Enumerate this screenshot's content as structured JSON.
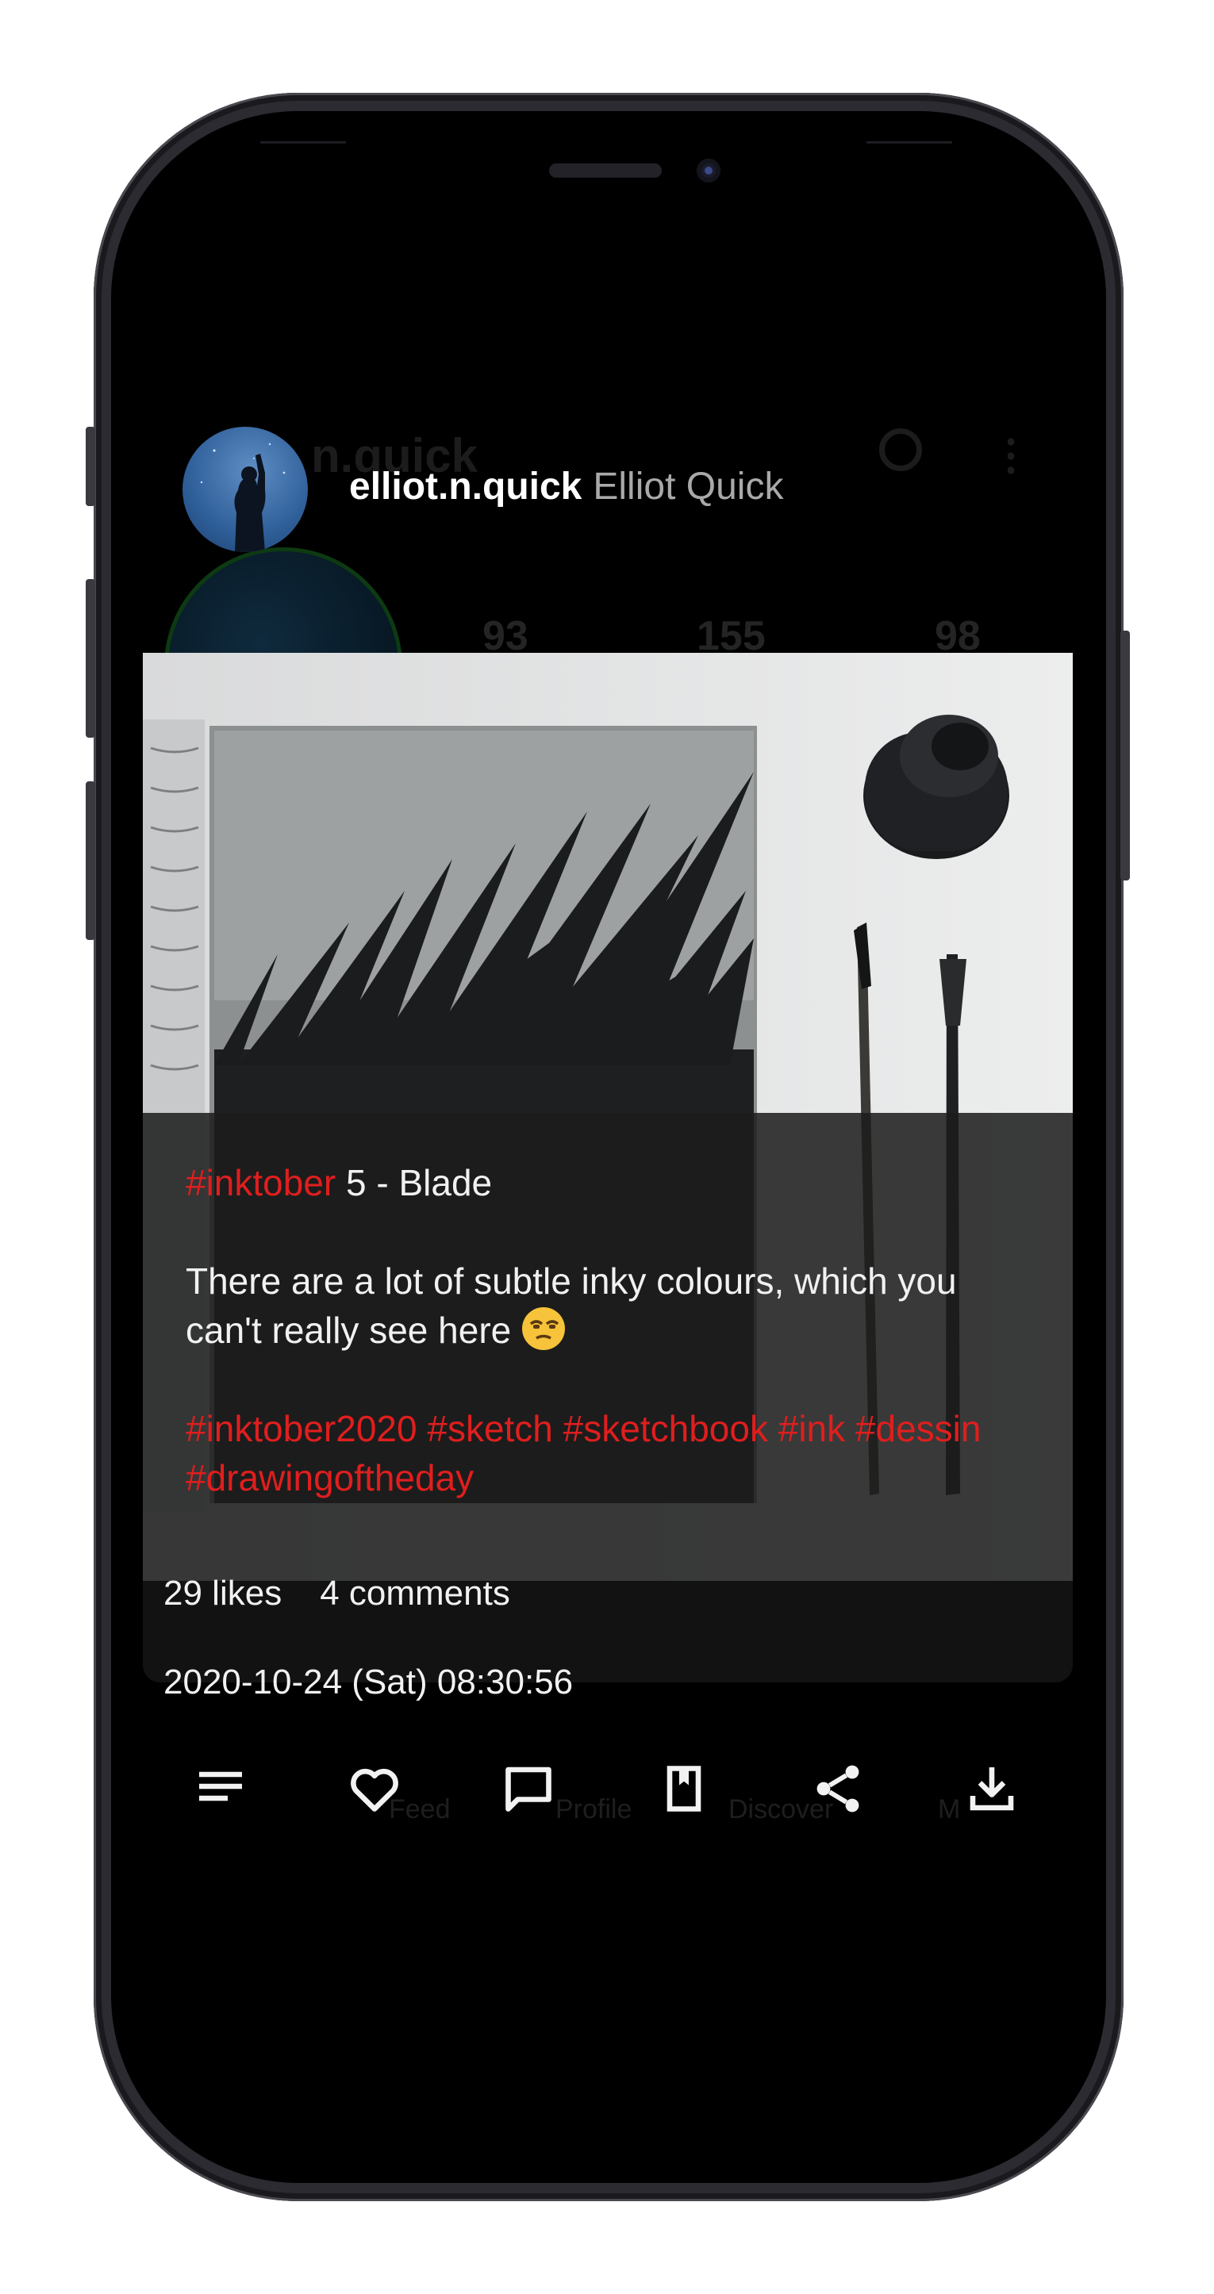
{
  "background_app": {
    "title": "n.quick",
    "stats": [
      "93",
      "155",
      "98"
    ],
    "nav_labels": [
      "Feed",
      "Profile",
      "Discover",
      "M"
    ]
  },
  "dialog": {
    "username": "elliot.n.quick",
    "full_name": "Elliot Quick",
    "caption": {
      "line1_tag": "#inktober",
      "line1_text": " 5 - Blade",
      "body": "There are a lot of subtle inky colours, which you can't really see here",
      "emoji": "unamused-face",
      "tags": [
        "#inktober2020",
        "#sketch",
        "#sketchbook",
        "#ink",
        "#dessin",
        "#drawingoftheday"
      ]
    },
    "likes": "29 likes",
    "comments": "4 comments",
    "timestamp": "2020-10-24 (Sat) 08:30:56",
    "actions": [
      {
        "icon": "menu-lines-icon",
        "label": "Details"
      },
      {
        "icon": "heart-icon",
        "label": "Like"
      },
      {
        "icon": "comment-icon",
        "label": "Comment"
      },
      {
        "icon": "bookmark-icon",
        "label": "Save"
      },
      {
        "icon": "share-icon",
        "label": "Share"
      },
      {
        "icon": "download-icon",
        "label": "Download"
      }
    ]
  },
  "colors": {
    "hashtag": "#e01e1e",
    "screen_bg": "#000000",
    "text": "#f1f1f1",
    "secondary_text": "#a9a9a9"
  }
}
